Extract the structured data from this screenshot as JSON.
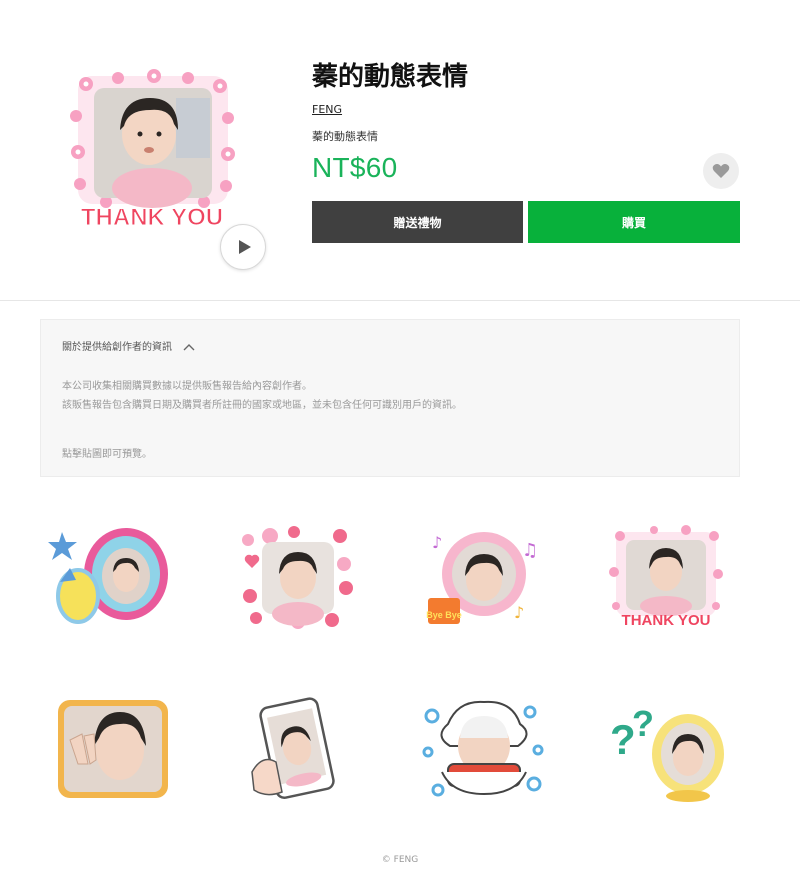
{
  "product": {
    "title": "蓁的動態表情",
    "author": "FENG",
    "description": "蓁的動態表情",
    "price": "NT$60",
    "gift_label": "贈送禮物",
    "buy_label": "購買",
    "main_image_text": "THANK YOU"
  },
  "info": {
    "heading": "關於提供給創作者的資訊",
    "line1": "本公司收集相關購買數據以提供販售報告給內容創作者。",
    "line2": "該販售報告包含購買日期及購買者所註冊的國家或地區，並未包含任何可識別用戶的資訊。",
    "line3": "點擊貼圖即可預覽。"
  },
  "stickers": [
    {
      "name": "O frame",
      "text": ""
    },
    {
      "name": "hearts frame",
      "text": ""
    },
    {
      "name": "bye bye",
      "text": "Bye Bye"
    },
    {
      "name": "thank you",
      "text": "THANK YOU"
    },
    {
      "name": "peace sign",
      "text": ""
    },
    {
      "name": "phone",
      "text": ""
    },
    {
      "name": "bathtub",
      "text": ""
    },
    {
      "name": "question",
      "text": ""
    }
  ],
  "footer": {
    "copyright": "© FENG"
  },
  "colors": {
    "accent_green": "#08b13b",
    "price_green": "#1ab35a",
    "gift_dark": "#404040"
  }
}
